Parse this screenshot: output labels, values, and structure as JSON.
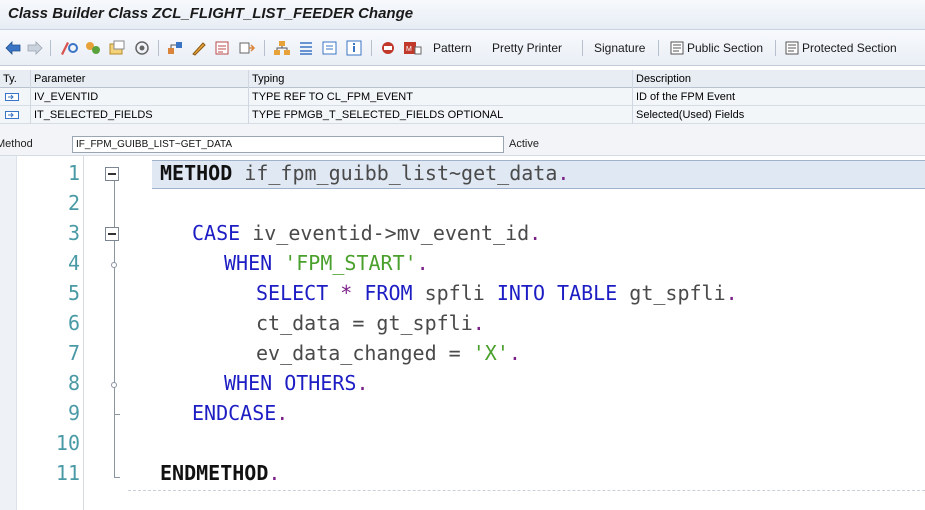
{
  "window": {
    "title": "Class Builder Class ZCL_FLIGHT_LIST_FEEDER Change"
  },
  "toolbar": {
    "icons": [
      "back-arrow-icon",
      "forward-arrow-icon",
      "other-object-icon",
      "display-change-icon",
      "active-inactive-icon",
      "activate-icon",
      "where-used-icon",
      "edit-object-icon",
      "check-icon",
      "layout-icon",
      "hierarchy-icon",
      "help-icon",
      "info-icon",
      "local-types-icon",
      "macro-icon"
    ],
    "pattern_label": "Pattern",
    "pretty_printer_label": "Pretty Printer",
    "signature_label": "Signature",
    "public_section_label": "Public Section",
    "protected_section_label": "Protected Section"
  },
  "params": {
    "headers": [
      "Ty.",
      "Parameter",
      "Typing",
      "Description"
    ],
    "rows": [
      {
        "parameter": "IV_EVENTID",
        "typing": "TYPE REF TO CL_FPM_EVENT",
        "description": "ID of the FPM Event"
      },
      {
        "parameter": "IT_SELECTED_FIELDS",
        "typing": "TYPE FPMGB_T_SELECTED_FIELDS OPTIONAL",
        "description": "Selected(Used) Fields"
      }
    ]
  },
  "method": {
    "label": "Method",
    "name": "IF_FPM_GUIBB_LIST~GET_DATA",
    "status": "Active"
  },
  "editor": {
    "line_numbers": [
      "1",
      "2",
      "3",
      "4",
      "5",
      "6",
      "7",
      "8",
      "9",
      "10",
      "11"
    ],
    "lines": {
      "l1_kw": "METHOD",
      "l1_name": " if_fpm_guibb_list~get_data",
      "l1_dot": ".",
      "l3_kw": "CASE",
      "l3_rest": " iv_eventid->mv_event_id",
      "l3_dot": ".",
      "l4_kw": "WHEN",
      "l4_str": " 'FPM_START'",
      "l4_dot": ".",
      "l5_kw1": "SELECT",
      "l5_star": " * ",
      "l5_kw2": "FROM",
      "l5_tab": " spfli ",
      "l5_kw3": "INTO TABLE",
      "l5_rest": " gt_spfli",
      "l5_dot": ".",
      "l6_rest": "ct_data = gt_spfli",
      "l6_dot": ".",
      "l7_rest": "ev_data_changed = ",
      "l7_str": "'X'",
      "l7_dot": ".",
      "l8_kw": "WHEN OTHERS",
      "l8_dot": ".",
      "l9_kw": "ENDCASE",
      "l9_dot": ".",
      "l11_kw": "ENDMETHOD",
      "l11_dot": "."
    }
  },
  "colors": {
    "keyword": "#1d1dc4",
    "string": "#4aa02c",
    "punctuation": "#7a1e88",
    "line_number": "#4a9aa6",
    "highlight": "#dfe8f3"
  }
}
